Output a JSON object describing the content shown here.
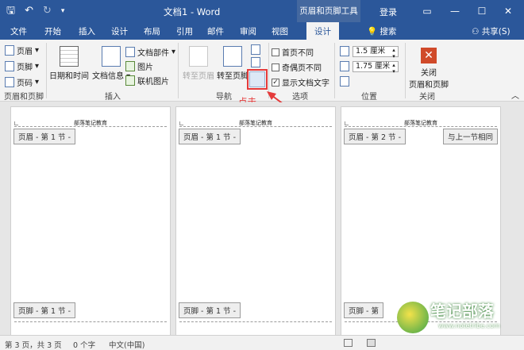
{
  "window": {
    "title": "文档1 - Word",
    "context_tab_title": "页眉和页脚工具",
    "login": "登录"
  },
  "tabs": [
    "文件",
    "开始",
    "插入",
    "设计",
    "布局",
    "引用",
    "邮件",
    "审阅",
    "视图",
    "设计"
  ],
  "search": "搜索",
  "share": "共享(S)",
  "ribbon": {
    "hf_group": {
      "header": "页眉",
      "footer": "页脚",
      "page_num": "页码",
      "label": "页眉和页脚"
    },
    "insert_group": {
      "datetime": "日期和时间",
      "docinfo": "文档信息",
      "parts": "文档部件",
      "picture": "图片",
      "online_picture": "联机图片",
      "label": "插入"
    },
    "nav_group": {
      "goto_header": "转至页眉",
      "goto_footer": "转至页脚",
      "label": "导航"
    },
    "options_group": {
      "diff_first": "首页不同",
      "diff_odd_even": "奇偶页不同",
      "show_text": "显示文档文字",
      "label": "选项"
    },
    "position_group": {
      "header_top": "1.5 厘米",
      "footer_bottom": "1.75 厘米",
      "label": "位置"
    },
    "close_group": {
      "close": "关闭",
      "close2": "页眉和页脚",
      "label": "关闭"
    }
  },
  "annotation": "点击",
  "pages": [
    {
      "header_text": "部落笔记教育",
      "header_tag": "页眉 - 第 1 节 -",
      "footer_tag": "页脚 - 第 1 节 -"
    },
    {
      "header_text": "部落笔记教育",
      "header_tag": "页眉 - 第 1 节 -",
      "footer_tag": "页脚 - 第 1 节 -"
    },
    {
      "header_text": "部落笔记教育",
      "header_tag": "页眉 - 第 2 节 -",
      "link_tag": "与上一节相同",
      "footer_tag": "页脚 - 第"
    }
  ],
  "status": {
    "pages": "第 3 页，共 3 页",
    "words": "0 个字",
    "lang": "中文(中国)"
  },
  "watermark": {
    "text": "笔记部落",
    "url": "www.notetribe.com"
  }
}
